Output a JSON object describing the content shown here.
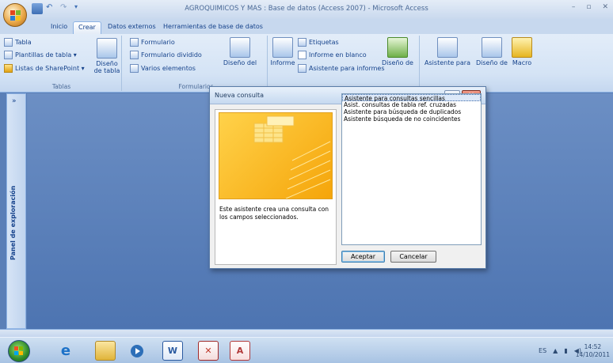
{
  "window": {
    "title": "AGROQUIMICOS Y MAS : Base de datos (Access 2007) - Microsoft Access",
    "minimize": "–",
    "maximize": "▫",
    "close": "✕"
  },
  "tabs": [
    {
      "label": "Inicio"
    },
    {
      "label": "Crear"
    },
    {
      "label": "Datos externos"
    },
    {
      "label": "Herramientas de base de datos"
    }
  ],
  "ribbon": {
    "tablas": {
      "group_label": "Tablas",
      "tabla": "Tabla",
      "plantillas": "Plantillas de tabla ▾",
      "listas": "Listas de SharePoint ▾",
      "diseno_line1": "Diseño",
      "diseno_line2": "de tabla"
    },
    "formularios": {
      "group_label": "Formularios",
      "formulario": "Formulario",
      "formulario_dividido": "Formulario dividido",
      "varios_elementos": "Varios elementos",
      "diseno_del": "Diseño del"
    },
    "informes": {
      "etiquetas": "Etiquetas",
      "informe_blanco": "Informe en blanco",
      "asistente_informes": "Asistente para informes",
      "informe": "Informe",
      "diseno_de": "Diseño de"
    },
    "otros": {
      "asistente_para": "Asistente para",
      "diseno_de": "Diseño de",
      "macro": "Macro"
    }
  },
  "nav": {
    "label": "Panel de exploración",
    "chevron": "»"
  },
  "dialog": {
    "title": "Nueva consulta",
    "help": "?",
    "close": "✕",
    "description": "Este asistente crea una consulta con los campos seleccionados.",
    "options": [
      {
        "label": "Asistente para consultas sencillas"
      },
      {
        "label": "Asist. consultas de tabla ref. cruzadas"
      },
      {
        "label": "Asistente para búsqueda de duplicados"
      },
      {
        "label": "Asistente búsqueda de no coincidentes"
      }
    ],
    "ok": "Aceptar",
    "cancel": "Cancelar"
  },
  "taskbar": {
    "language": "ES",
    "time": "14:52",
    "date": "14/10/2011",
    "word_letter": "W"
  }
}
